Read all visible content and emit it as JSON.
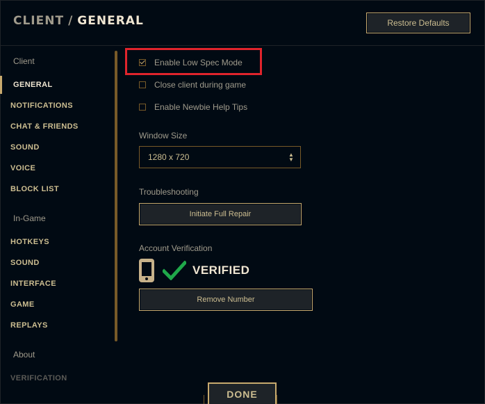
{
  "header": {
    "section": "CLIENT",
    "separator": "/",
    "current": "GENERAL",
    "restore_label": "Restore Defaults"
  },
  "sidebar": {
    "client_label": "Client",
    "client_items": [
      {
        "label": "GENERAL",
        "active": true
      },
      {
        "label": "NOTIFICATIONS"
      },
      {
        "label": "CHAT & FRIENDS"
      },
      {
        "label": "SOUND"
      },
      {
        "label": "VOICE"
      },
      {
        "label": "BLOCK LIST"
      }
    ],
    "ingame_label": "In-Game",
    "ingame_items": [
      {
        "label": "HOTKEYS"
      },
      {
        "label": "SOUND"
      },
      {
        "label": "INTERFACE"
      },
      {
        "label": "GAME"
      },
      {
        "label": "REPLAYS"
      }
    ],
    "about_label": "About",
    "about_items": [
      {
        "label": "VERIFICATION"
      }
    ]
  },
  "options": {
    "low_spec": {
      "label": "Enable Low Spec Mode",
      "checked": true
    },
    "close_client": {
      "label": "Close client during game",
      "checked": false
    },
    "newbie_tips": {
      "label": "Enable Newbie Help Tips",
      "checked": false
    }
  },
  "window_size": {
    "label": "Window Size",
    "value": "1280 x 720"
  },
  "troubleshooting": {
    "label": "Troubleshooting",
    "repair_label": "Initiate Full Repair"
  },
  "account": {
    "label": "Account Verification",
    "status": "VERIFIED",
    "remove_label": "Remove Number"
  },
  "footer": {
    "done_label": "DONE"
  },
  "colors": {
    "background": "#010a13",
    "gold": "#c8aa6e",
    "highlight": "#e0242c",
    "verified_check": "#1fa84a"
  },
  "icons": {
    "phone": "phone-icon",
    "check": "checkmark-icon",
    "select_arrows": "chevron-up-down-icon"
  }
}
